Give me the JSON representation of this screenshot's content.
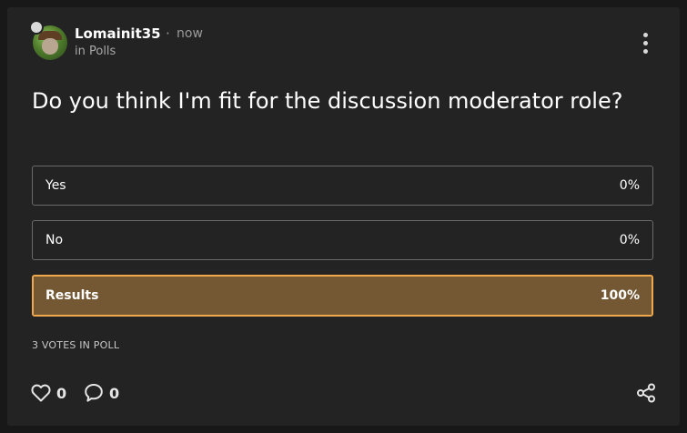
{
  "post": {
    "username": "Lomainit35",
    "separator": "·",
    "time": "now",
    "category": "in Polls",
    "question": "Do you think I'm fit for the discussion moderator role?"
  },
  "poll": {
    "options": [
      {
        "label": "Yes",
        "percent": "0%"
      },
      {
        "label": "No",
        "percent": "0%"
      }
    ],
    "results": {
      "label": "Results",
      "percent": "100%",
      "fill_fraction": 1.0
    },
    "votes_text": "3 VOTES IN POLL"
  },
  "footer": {
    "likes": "0",
    "comments": "0"
  },
  "icons": {
    "menu": "kebab-menu-icon",
    "like": "heart-icon",
    "comment": "comment-bubble-icon",
    "share": "share-icon",
    "badge": "badge-icon"
  },
  "colors": {
    "background": "#181818",
    "card": "#232323",
    "option_border": "#6a6a6a",
    "results_fill": "#745733",
    "results_border": "#f0a84c",
    "text_muted": "#9a9a9a"
  }
}
